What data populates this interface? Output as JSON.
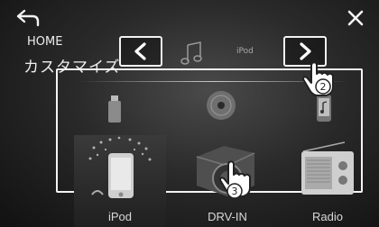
{
  "header": {
    "home_label": "HOME",
    "title": "カスタマイズ"
  },
  "source_strip": {
    "ipod_small_text": "iPod"
  },
  "sources": [
    {
      "label": "iPod",
      "icon": "ipod-icon"
    },
    {
      "label": "DRV-IN",
      "icon": "drive-recorder-icon"
    },
    {
      "label": "Radio",
      "icon": "radio-icon"
    }
  ],
  "callouts": {
    "right_number": "2",
    "center_number": "3"
  },
  "colors": {
    "frame": "#f4f4f4",
    "background": "#2a2a2a",
    "text": "#d8d8d8"
  }
}
